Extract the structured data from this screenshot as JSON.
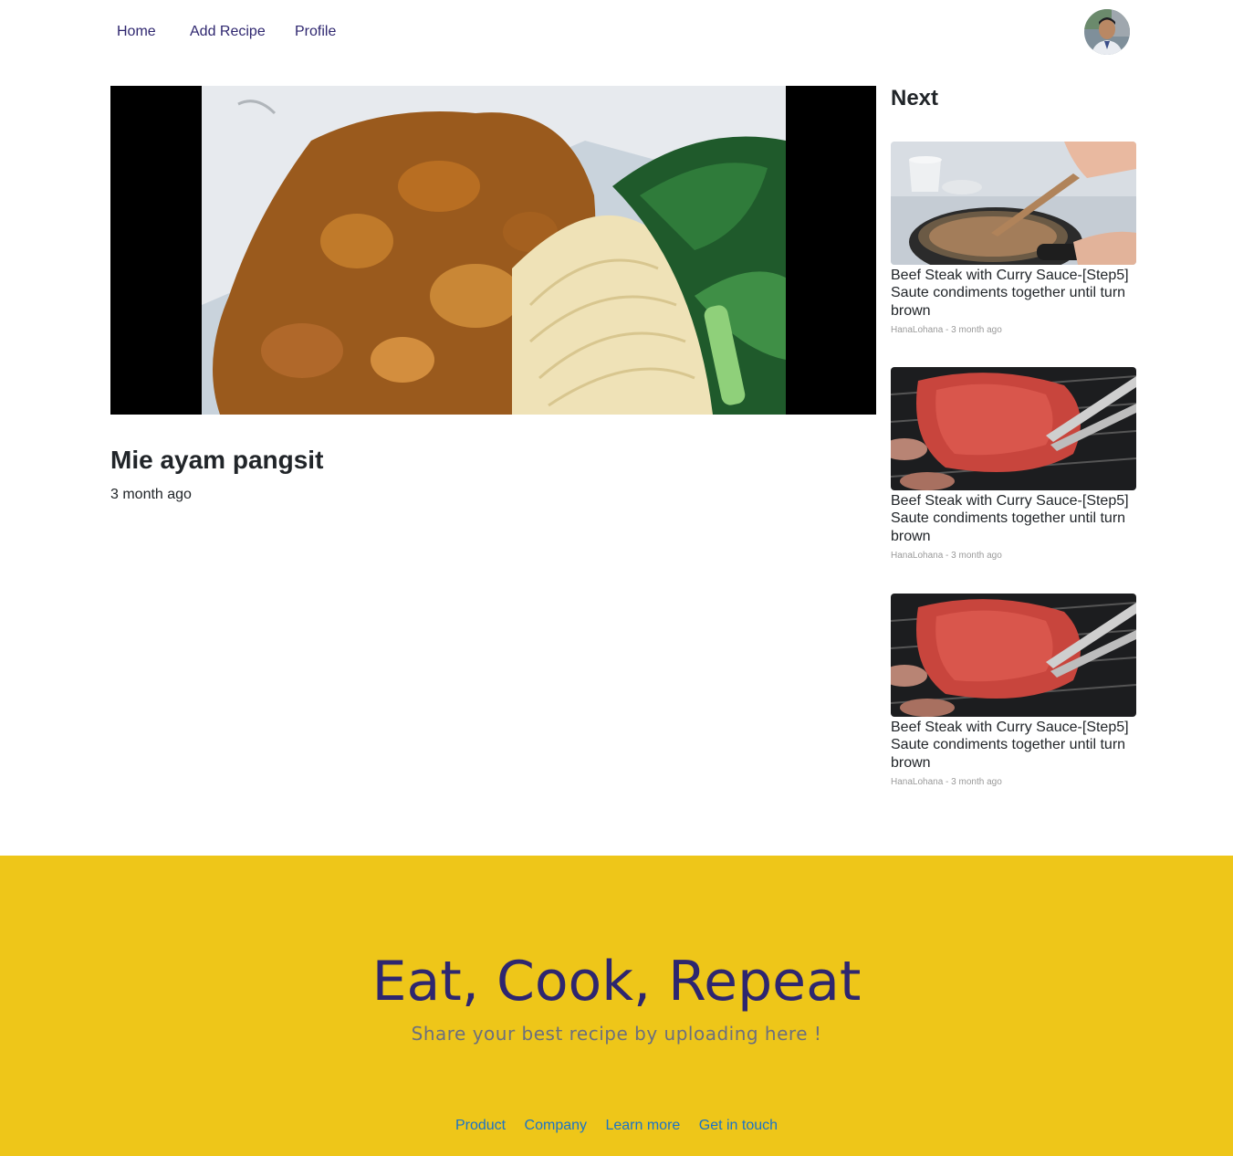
{
  "nav": {
    "items": [
      {
        "label": "Home"
      },
      {
        "label": "Add Recipe"
      },
      {
        "label": "Profile"
      }
    ]
  },
  "recipe": {
    "title": "Mie ayam pangsit",
    "time": "3 month ago"
  },
  "sidebar": {
    "heading": "Next",
    "cards": [
      {
        "title": "Beef Steak with Curry Sauce-[Step5] Saute condiments together until turn brown",
        "meta": "HanaLohana - 3 month ago"
      },
      {
        "title": "Beef Steak with Curry Sauce-[Step5] Saute condiments together until turn brown",
        "meta": "HanaLohana - 3 month ago"
      },
      {
        "title": "Beef Steak with Curry Sauce-[Step5] Saute condiments together until turn brown",
        "meta": "HanaLohana - 3 month ago"
      }
    ]
  },
  "footer": {
    "title": "Eat, Cook, Repeat",
    "subtitle": "Share your best recipe by uploading here !",
    "links": [
      {
        "label": "Product"
      },
      {
        "label": "Company"
      },
      {
        "label": "Learn more"
      },
      {
        "label": "Get in touch"
      }
    ]
  },
  "colors": {
    "nav_text": "#2e266f",
    "footer_bg": "#eec619",
    "footer_title": "#2e266f",
    "footer_link": "#1a73c8"
  }
}
